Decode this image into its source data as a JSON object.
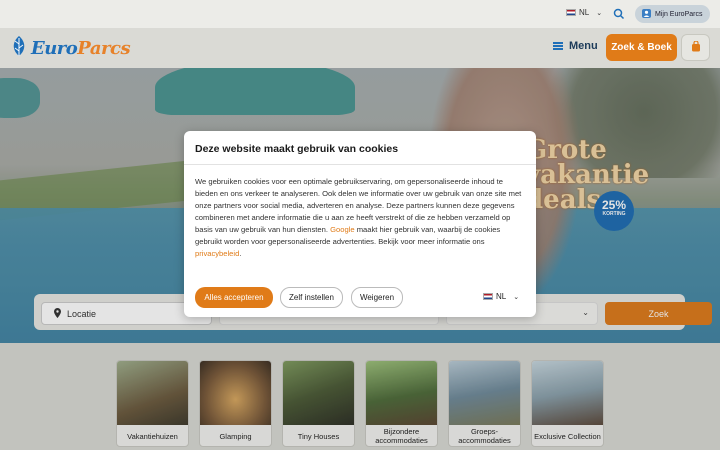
{
  "topbar": {
    "language": "NL",
    "account_label": "Mijn EuroParcs"
  },
  "header": {
    "logo_part1": "Euro",
    "logo_part2": "Parcs",
    "menu_label": "Menu",
    "book_button": "Zoek & Boek"
  },
  "hero": {
    "promo_line1": "Grote",
    "promo_line2": "vakantie",
    "promo_line3": "deals",
    "badge_percent": "25%",
    "badge_text": "KORTING"
  },
  "search": {
    "location_label": "Locatie",
    "search_button": "Zoek"
  },
  "categories": [
    {
      "label": "Vakantiehuizen",
      "color": "#6b5a3e"
    },
    {
      "label": "Glamping",
      "color": "#7a5a3a"
    },
    {
      "label": "Tiny Houses",
      "color": "#4b5a36"
    },
    {
      "label": "Bijzondere accommodaties",
      "color": "#4e6b3a"
    },
    {
      "label": "Groeps-accommodaties",
      "color": "#6f8a9a"
    },
    {
      "label": "Exclusive Collection",
      "color": "#8aa0ab"
    }
  ],
  "cookie_dialog": {
    "title": "Deze website maakt gebruik van cookies",
    "body_part1": "We gebruiken cookies voor een optimale gebruikservaring, om gepersonaliseerde inhoud te bieden en ons verkeer te analyseren. Ook delen we informatie over uw gebruik van onze site met onze partners voor social media, adverteren en analyse. Deze partners kunnen deze gegevens combineren met andere informatie die u aan ze heeft verstrekt of die ze hebben verzameld op basis van uw gebruik van hun diensten. ",
    "google_link": "Google",
    "body_part2": " maakt hier gebruik van, waarbij de cookies gebruikt worden voor gepersonaliseerde advertenties. Bekijk voor meer informatie ons ",
    "privacy_link": "privacybeleid",
    "body_end": ".",
    "accept_button": "Alles accepteren",
    "settings_button": "Zelf instellen",
    "decline_button": "Weigeren",
    "language": "NL"
  },
  "colors": {
    "brand_orange": "#e07b18",
    "brand_blue": "#1f6fb8"
  }
}
